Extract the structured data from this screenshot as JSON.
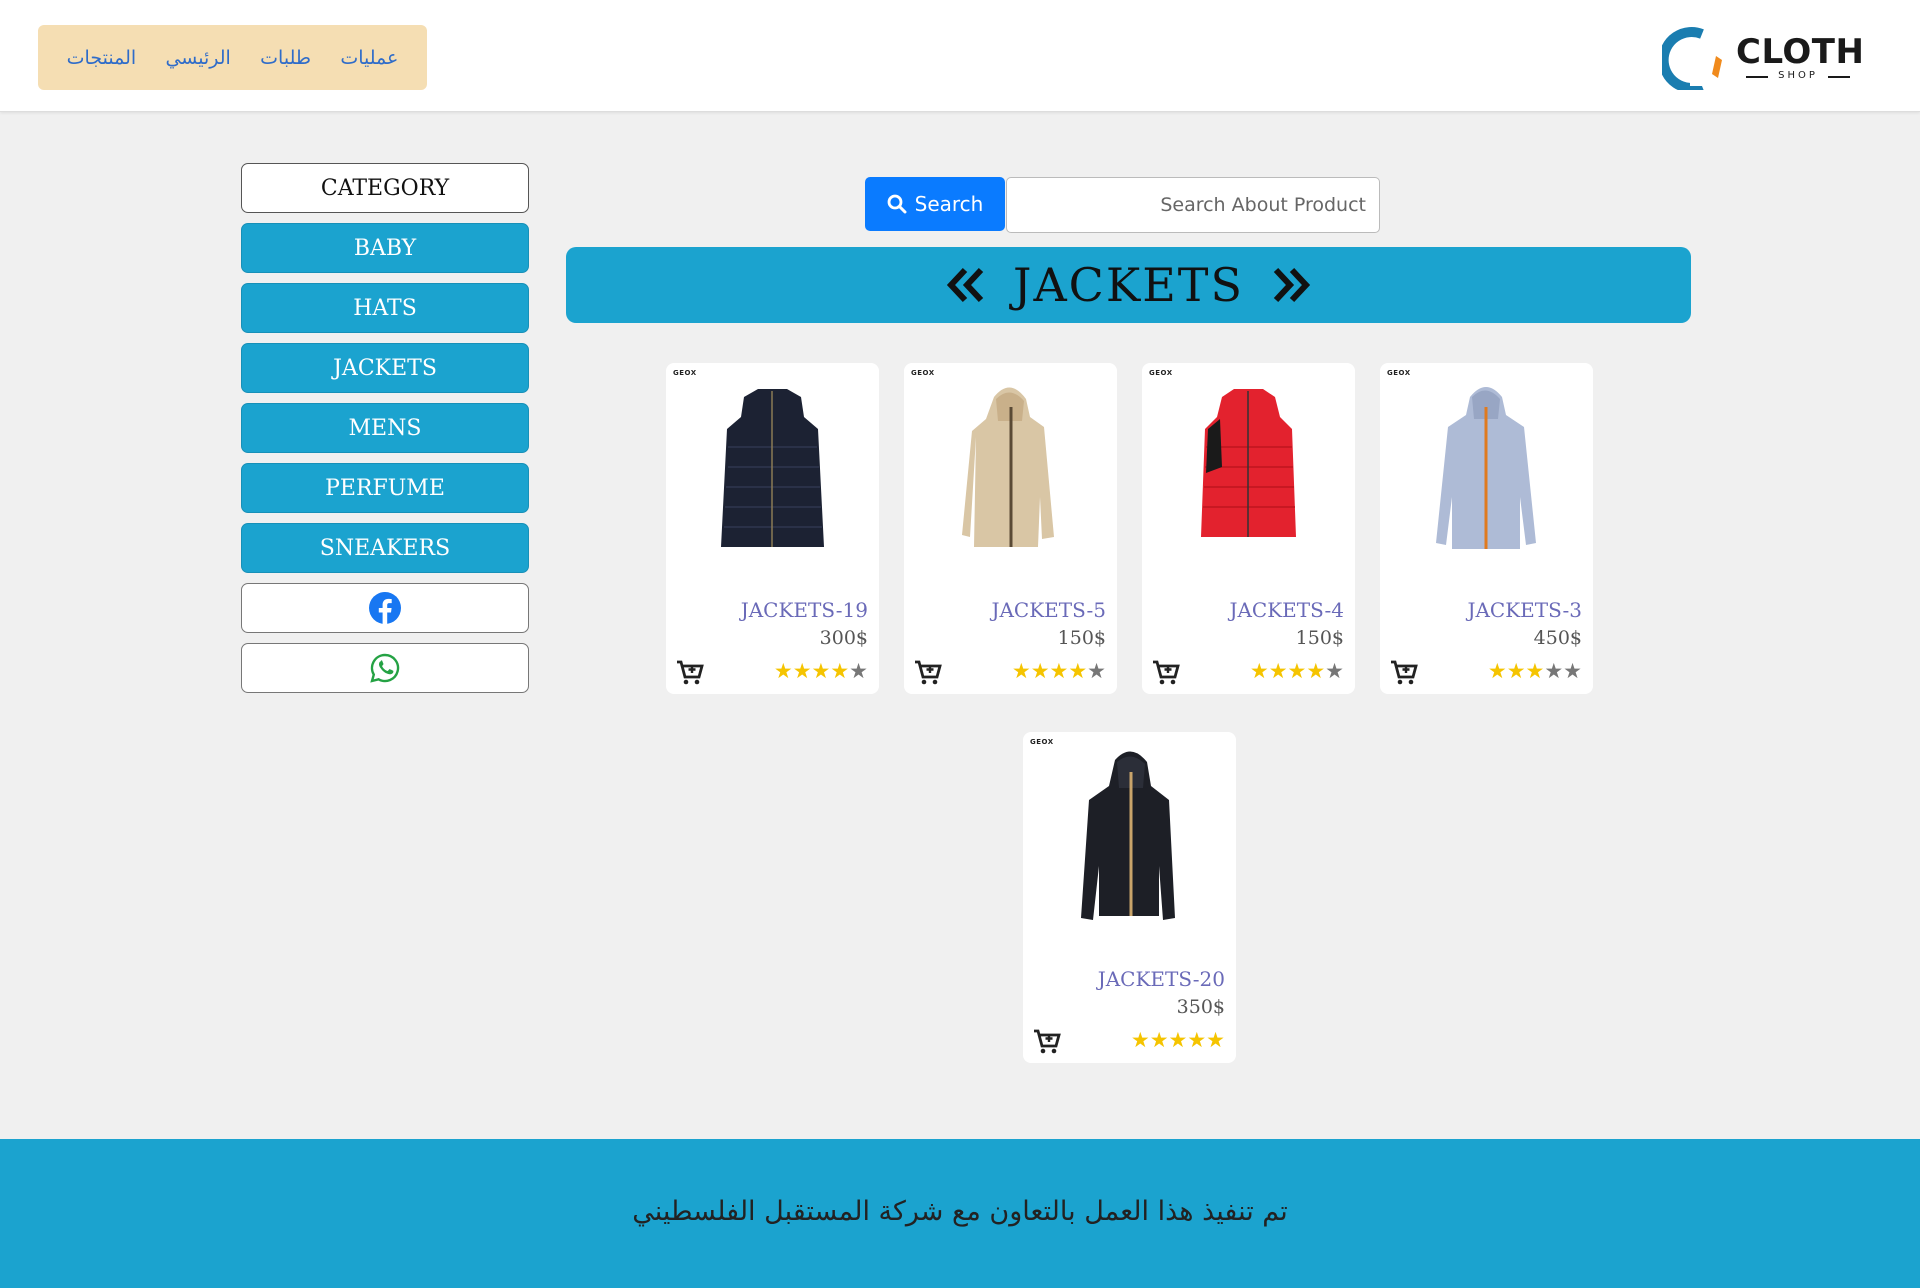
{
  "nav": {
    "items": [
      "عمليات",
      "طلبات",
      "الرئيسي",
      "المنتجات"
    ]
  },
  "logo": {
    "name": "CLOTH",
    "sub": "SHOP"
  },
  "sidebar": {
    "category_label": "Category",
    "items": [
      "baby",
      "hats",
      "jackets",
      "mens",
      "perfume",
      "sneakers"
    ]
  },
  "search": {
    "button_label": "Search",
    "placeholder": "Search About Product"
  },
  "banner": {
    "title": "Jackets"
  },
  "products": [
    {
      "brand": "GEOX",
      "name": "jackets-19",
      "price": "300$",
      "rating": 4,
      "color": "#1c2233"
    },
    {
      "brand": "GEOX",
      "name": "jackets-5",
      "price": "150$",
      "rating": 4,
      "color": "#d9c6a5"
    },
    {
      "brand": "GEOX",
      "name": "jackets-4",
      "price": "150$",
      "rating": 4,
      "color": "#e3222e"
    },
    {
      "brand": "GEOX",
      "name": "jackets-3",
      "price": "450$",
      "rating": 3,
      "color": "#aebbd6"
    },
    {
      "brand": "GEOX",
      "name": "jackets-20",
      "price": "350$",
      "rating": 5,
      "color": "#1d1f26"
    }
  ],
  "footer": {
    "text": "تم تنفيذ هذا العمل بالتعاون مع شركة المستقبل الفلسطيني"
  },
  "colors": {
    "accent": "#1ba3cf",
    "nav_bg": "#f5deb3",
    "search_button": "#0a7bff",
    "star": "#f5c400"
  }
}
